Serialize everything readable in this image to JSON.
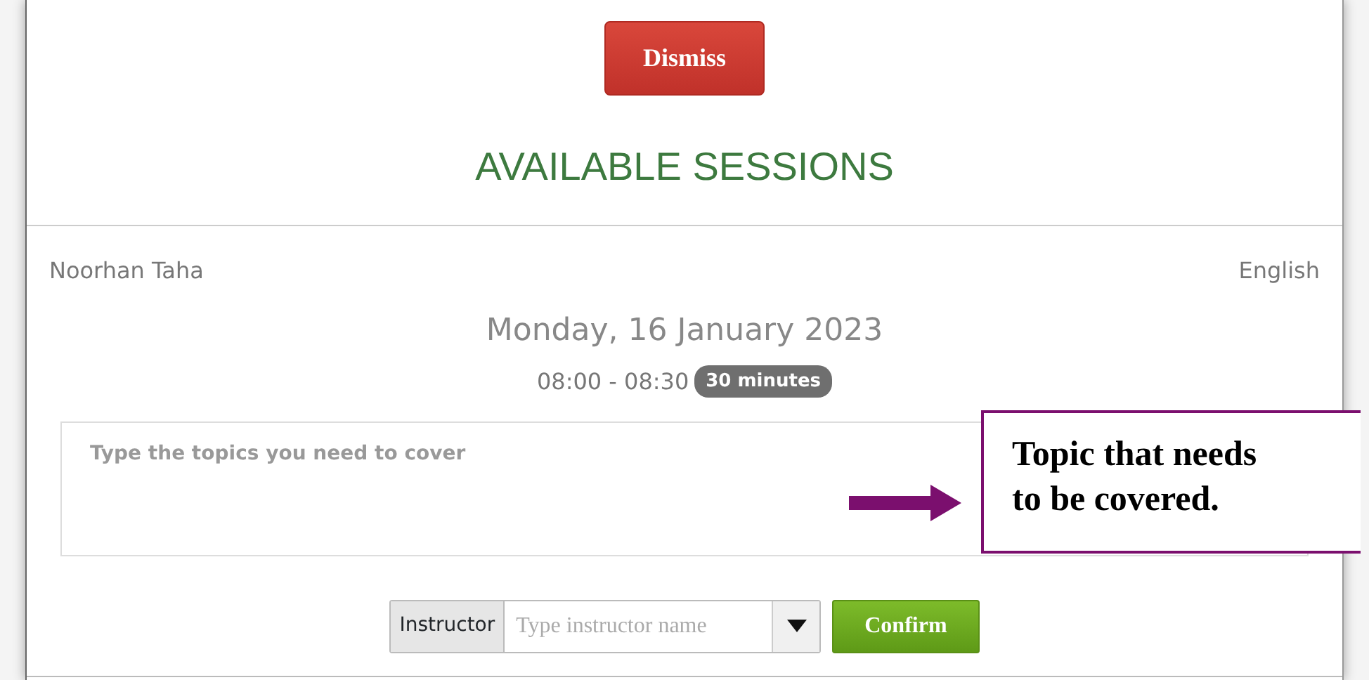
{
  "dismiss_button": "Dismiss",
  "title": "AVAILABLE SESSIONS",
  "session": {
    "instructor_name": "Noorhan Taha",
    "language": "English",
    "date": "Monday, 16 January 2023",
    "time": "08:00 - 08:30",
    "duration": "30 minutes"
  },
  "topics_field": {
    "placeholder": "Type the topics you need to cover"
  },
  "instructor_field": {
    "label": "Instructor",
    "placeholder": "Type instructor name"
  },
  "confirm_button": "Confirm",
  "annotation": {
    "text": "Topic that needs to be covered."
  }
}
